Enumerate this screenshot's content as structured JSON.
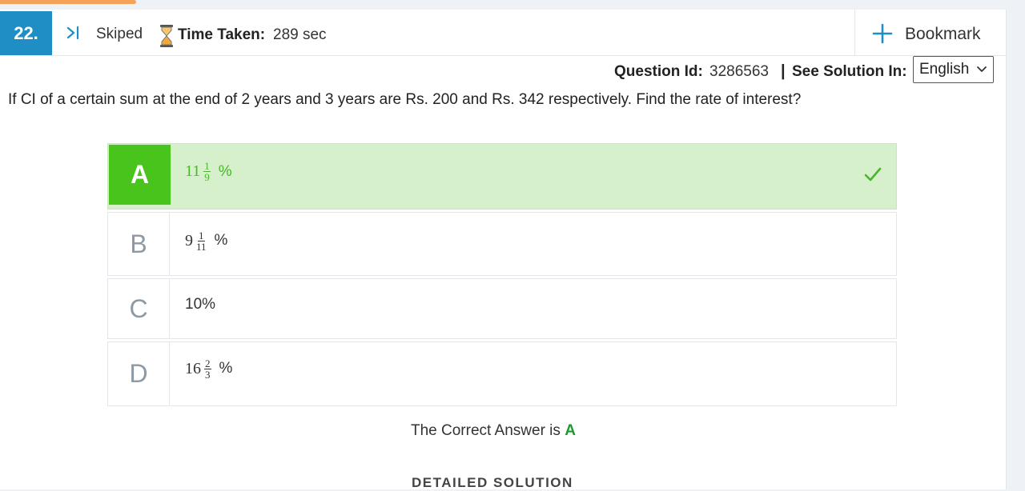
{
  "header": {
    "question_number": "22.",
    "skip_label": "Skiped",
    "time_label": "Time Taken:",
    "time_value": "289 sec",
    "bookmark_label": "Bookmark"
  },
  "meta": {
    "question_id_label": "Question Id:",
    "question_id_value": "3286563",
    "separator": "|",
    "solution_label": "See Solution In:",
    "language_selected": "English"
  },
  "question": {
    "text": "If CI of a certain sum at the end of 2 years and 3 years are Rs. 200 and Rs. 342 respectively. Find the rate of interest?"
  },
  "options": [
    {
      "letter": "A",
      "whole": "11",
      "num": "1",
      "den": "9",
      "suffix": "%",
      "correct": true
    },
    {
      "letter": "B",
      "whole": "9",
      "num": "1",
      "den": "11",
      "suffix": "%",
      "correct": false
    },
    {
      "letter": "C",
      "text": "10%",
      "correct": false
    },
    {
      "letter": "D",
      "whole": "16",
      "num": "2",
      "den": "3",
      "suffix": "%",
      "correct": false
    }
  ],
  "answer": {
    "prefix": "The Correct Answer is",
    "letter": "A"
  },
  "solution": {
    "heading": "DETAILED SOLUTION"
  },
  "colors": {
    "accent_blue": "#1f8ec5",
    "correct_green": "#49c41c",
    "correct_bg": "#d6f0cc",
    "progress_orange": "#f5a35a"
  },
  "icons": [
    "skip-icon",
    "hourglass-icon",
    "plus-icon",
    "chevron-down-icon",
    "check-icon"
  ]
}
